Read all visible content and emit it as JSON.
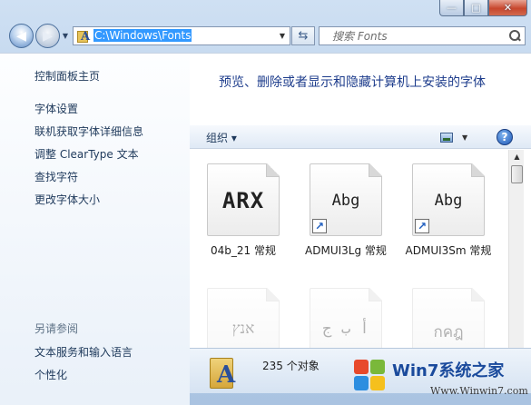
{
  "window": {
    "caption_minimize": "—",
    "caption_maximize": "□",
    "caption_close": "✕"
  },
  "address_bar": {
    "path": "C:\\Windows\\Fonts"
  },
  "search": {
    "placeholder": "搜索 Fonts"
  },
  "sidebar": {
    "items": [
      {
        "label": "控制面板主页"
      },
      {
        "label": "字体设置"
      },
      {
        "label": "联机获取字体详细信息"
      },
      {
        "label": "调整 ClearType 文本"
      },
      {
        "label": "查找字符"
      },
      {
        "label": "更改字体大小"
      }
    ],
    "see_also_heading": "另请参阅",
    "see_also": [
      {
        "label": "文本服务和输入语言"
      },
      {
        "label": "个性化"
      }
    ]
  },
  "content": {
    "description": "预览、删除或者显示和隐藏计算机上安装的字体"
  },
  "toolbar": {
    "organize_label": "组织 ▾",
    "help_label": "?"
  },
  "fonts": [
    {
      "name": "04b_21 常规",
      "sample": "ARX",
      "shortcut": false
    },
    {
      "name": "ADMUI3Lg 常规",
      "sample": "Abg",
      "shortcut": true
    },
    {
      "name": "ADMUI3Sm 常规",
      "sample": "Abg",
      "shortcut": true
    },
    {
      "name": "",
      "sample": "אנץ",
      "shortcut": false
    },
    {
      "name": "",
      "sample": "أ ب ج",
      "shortcut": false
    },
    {
      "name": "",
      "sample": "กคฎ",
      "shortcut": false
    }
  ],
  "status": {
    "count": "235 个对象"
  },
  "watermark": {
    "title": "Win7系统之家",
    "url": "Www.Winwin7.com"
  },
  "colors": {
    "accent_link": "#1e395b",
    "heading_blue": "#1e3d8c",
    "selection": "#3399ff"
  }
}
